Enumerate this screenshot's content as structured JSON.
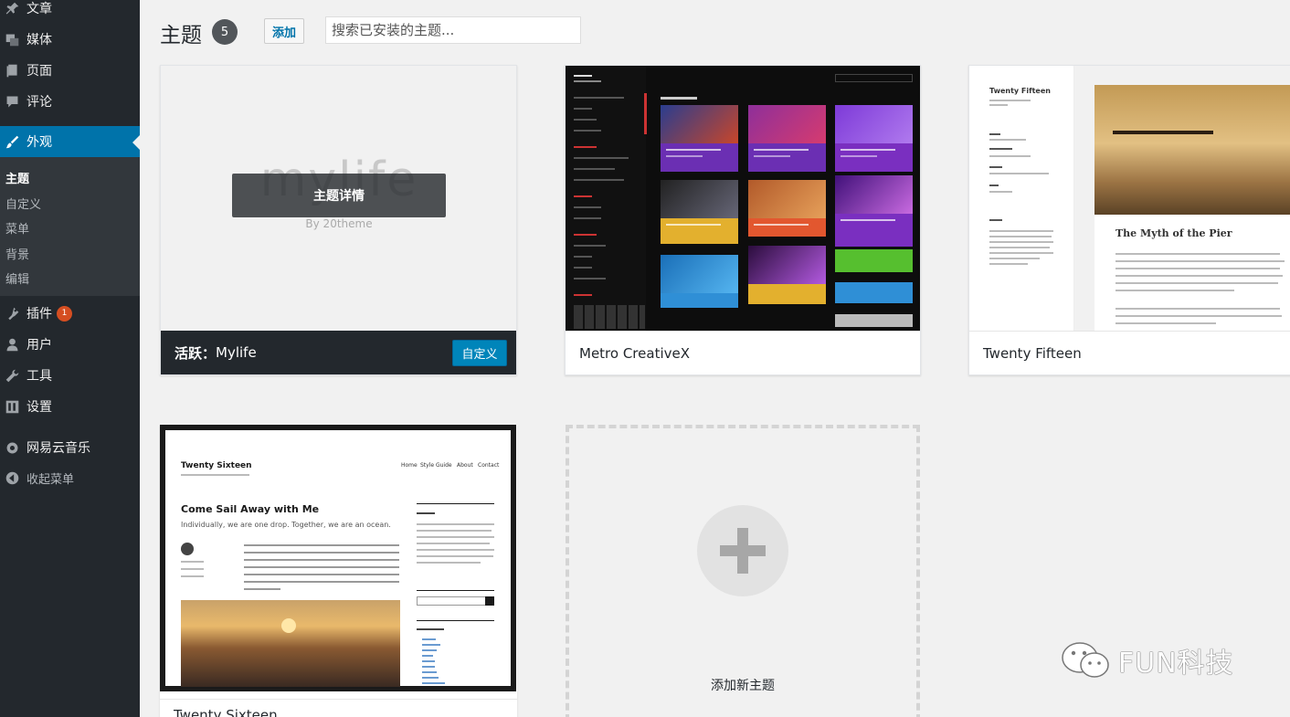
{
  "sidebar": {
    "items": [
      {
        "label": "文章",
        "icon": "pin-icon"
      },
      {
        "label": "媒体",
        "icon": "media-icon"
      },
      {
        "label": "页面",
        "icon": "page-icon"
      },
      {
        "label": "评论",
        "icon": "comment-icon"
      },
      {
        "label": "外观",
        "icon": "brush-icon",
        "active": true
      },
      {
        "label": "插件",
        "icon": "plugin-icon",
        "badge": "1"
      },
      {
        "label": "用户",
        "icon": "user-icon"
      },
      {
        "label": "工具",
        "icon": "wrench-icon"
      },
      {
        "label": "设置",
        "icon": "settings-icon"
      },
      {
        "label": "网易云音乐",
        "icon": "gear-icon"
      },
      {
        "label": "收起菜单",
        "icon": "collapse-icon"
      }
    ],
    "submenu": [
      {
        "label": "主题",
        "current": true
      },
      {
        "label": "自定义"
      },
      {
        "label": "菜单"
      },
      {
        "label": "背景"
      },
      {
        "label": "编辑"
      }
    ]
  },
  "header": {
    "title": "主题",
    "count": "5",
    "add_label": "添加",
    "search_placeholder": "搜索已安装的主题..."
  },
  "themes": {
    "active": {
      "logo": "mylife",
      "by": "By 20theme",
      "details_label": "主题详情",
      "active_label": "活跃：",
      "name": "Mylife",
      "customize_label": "自定义"
    },
    "metro": {
      "name": "Metro CreativeX"
    },
    "fifteen": {
      "name": "Twenty Fifteen",
      "preview_title": "The Myth of the Pier",
      "preview_site": "Twenty Fifteen"
    },
    "sixteen": {
      "name": "Twenty Sixteen",
      "preview_site": "Twenty Sixteen",
      "preview_nav": [
        "Home",
        "Style Guide",
        "About",
        "Contact"
      ],
      "preview_heading": "Come Sail Away with Me",
      "preview_sub": "Individually, we are one drop. Together, we are an ocean."
    }
  },
  "add_new": {
    "label": "添加新主题"
  },
  "watermark": {
    "text": "FUN科技"
  },
  "colors": {
    "sidebar_bg": "#23282d",
    "accent": "#0073aa",
    "badge": "#d54e21"
  }
}
